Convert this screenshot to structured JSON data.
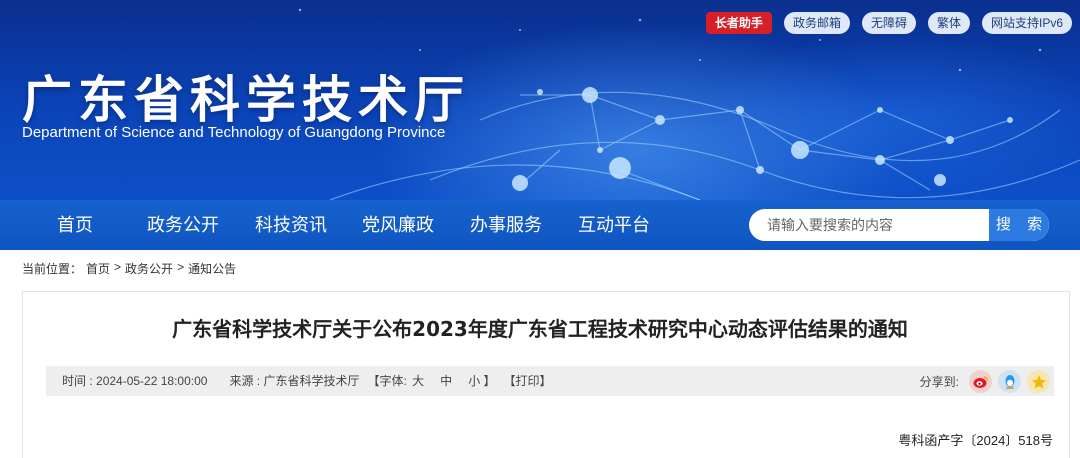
{
  "header": {
    "site_title": "广东省科学技术厅",
    "site_subtitle": "Department of Science and Technology of Guangdong Province",
    "top_links": [
      "长者助手",
      "政务邮箱",
      "无障碍",
      "繁体",
      "网站支持IPv6"
    ]
  },
  "nav": {
    "items": [
      "首页",
      "政务公开",
      "科技资讯",
      "党风廉政",
      "办事服务",
      "互动平台"
    ],
    "search_placeholder": "请输入要搜索的内容",
    "search_button": "搜 索"
  },
  "breadcrumb": {
    "prefix": "当前位置：",
    "items": [
      "首页",
      "政务公开",
      "通知公告"
    ],
    "separator": ">"
  },
  "article": {
    "title": "广东省科学技术厅关于公布2023年度广东省工程技术研究中心动态评估结果的通知",
    "time_label": "时间 : ",
    "time_value": "2024-05-22 18:00:00",
    "source_label": "来源 : ",
    "source_value": "广东省科学技术厅",
    "font_label": "【字体: ",
    "font_sizes": [
      "大",
      "中",
      "小"
    ],
    "font_close": " 】",
    "print_label": "【打印】",
    "share_label": "分享到:",
    "share_icons": [
      "weibo-icon",
      "qq-icon",
      "qzone-icon"
    ],
    "doc_number": "粤科函产字〔2024〕518号"
  },
  "colors": {
    "banner_dark": "#0a2f8f",
    "nav_blue": "#1762cf",
    "search_button": "#2d7ae0",
    "elder_badge": "#d61f26",
    "meta_bar": "#eeeeee"
  }
}
